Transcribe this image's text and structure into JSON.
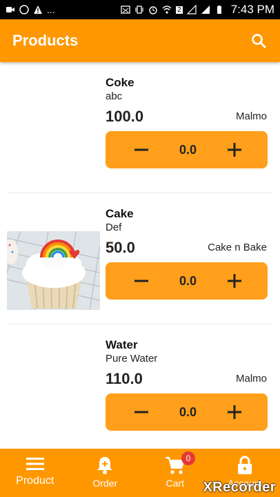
{
  "status_bar": {
    "time": "7:43 PM",
    "left_text": "...",
    "sim_badge": "2"
  },
  "app_bar": {
    "title": "Products",
    "icon": "search-icon"
  },
  "products": [
    {
      "name": "Coke",
      "description": "abc",
      "price": "100.0",
      "store": "Malmo",
      "quantity": "0.0",
      "has_image": false
    },
    {
      "name": "Cake",
      "description": "Def",
      "price": "50.0",
      "store": "Cake n Bake",
      "quantity": "0.0",
      "has_image": true,
      "image_icon": "cupcake-image"
    },
    {
      "name": "Water",
      "description": "Pure Water",
      "price": "110.0",
      "store": "Malmo",
      "quantity": "0.0",
      "has_image": false
    }
  ],
  "bottom_nav": {
    "items": [
      {
        "label": "Product",
        "icon": "menu-icon",
        "active": true
      },
      {
        "label": "Order",
        "icon": "bell-icon"
      },
      {
        "label": "Cart",
        "icon": "cart-icon",
        "badge": "0"
      },
      {
        "label": "Account",
        "icon": "lock-icon"
      }
    ]
  },
  "watermark": "XRecorder",
  "colors": {
    "primary": "#FF9800",
    "button": "#FF9F1C",
    "badge": "#E53935"
  }
}
